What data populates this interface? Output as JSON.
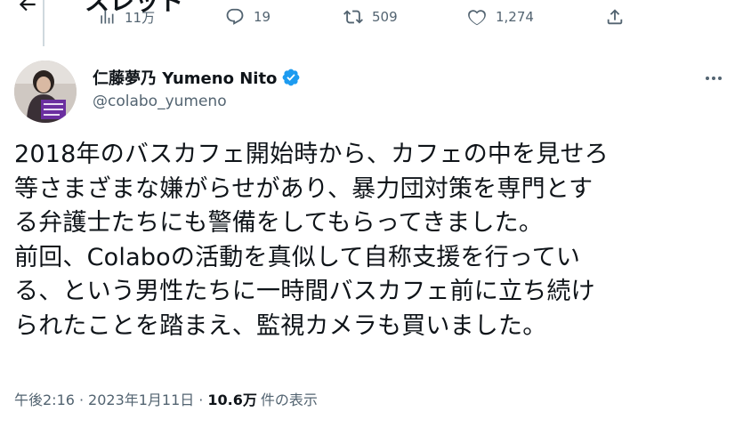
{
  "header": {
    "back_icon": "arrow-left-icon",
    "title": "スレッド"
  },
  "parent_tweet_stats": {
    "views": "11万",
    "replies": "19",
    "retweets": "509",
    "likes": "1,274"
  },
  "tweet": {
    "author": {
      "display_name": "仁藤夢乃 Yumeno Nito",
      "handle": "@colabo_yumeno",
      "verified": true,
      "verified_color": "#1d9bf0"
    },
    "text_lines": [
      "2018年のバスカフェ開始時から、カフェの中を見せろ",
      "等さまざまな嫌がらせがあり、暴力団対策を専門とす",
      "る弁護士たちにも警備をしてもらってきました。",
      "前回、Colaboの活動を真似して自称支援を行ってい",
      "る、という男性たちに一時間バスカフェ前に立ち続け",
      "られたことを踏まえ、監視カメラも買いました。"
    ],
    "time": "午後2:16",
    "date": "2023年1月11日",
    "separator": "·",
    "views_count": "10.6万",
    "views_label": "件の表示"
  },
  "colors": {
    "text_primary": "#0f1419",
    "text_secondary": "#536471",
    "avatar_sign": "#6b2fa0"
  }
}
